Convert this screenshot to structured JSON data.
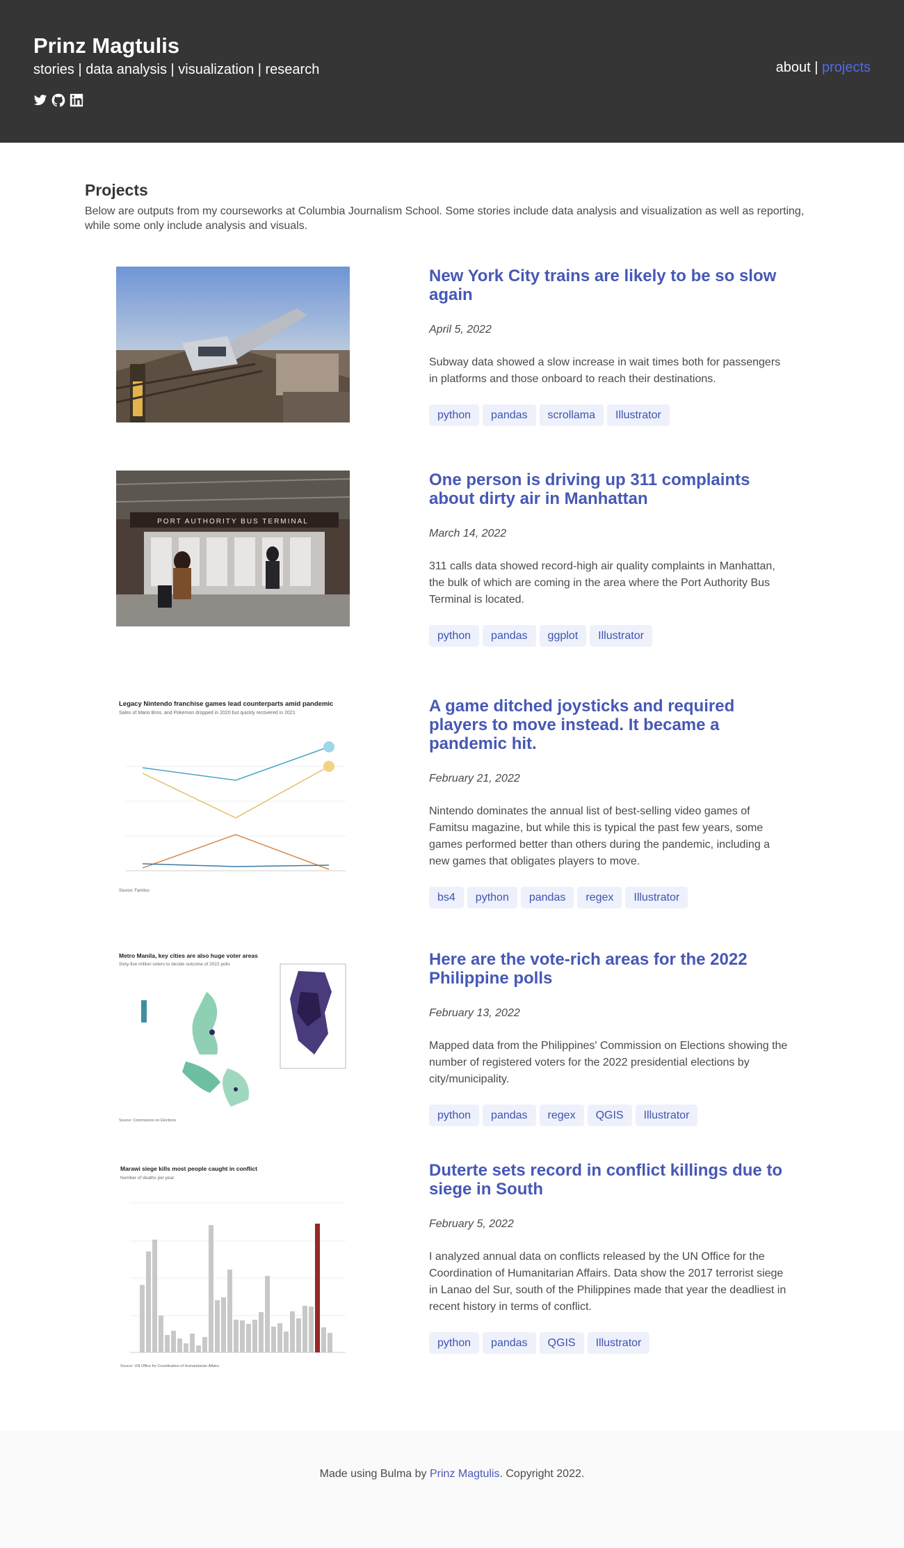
{
  "header": {
    "title": "Prinz Magtulis",
    "subtitle": "stories | data analysis | visualization | research",
    "social_icons": [
      "twitter-icon",
      "github-icon",
      "linkedin-icon"
    ],
    "nav": {
      "about": "about",
      "separator": " | ",
      "projects": "projects"
    }
  },
  "main": {
    "section_title": "Projects",
    "intro": "Below are outputs from my courseworks at Columbia Journalism School. Some stories include data analysis and visualization as well as reporting, while some only include analysis and visuals."
  },
  "projects": [
    {
      "title": "New York City trains are likely to be so slow again",
      "date": "April 5, 2022",
      "description": "Subway data showed a slow increase in wait times both for passengers in platforms and those onboard to reach their destinations.",
      "tags": [
        "python",
        "pandas",
        "scrollama",
        "Illustrator"
      ]
    },
    {
      "title": "One person is driving up 311 complaints about dirty air in Manhattan",
      "date": "March 14, 2022",
      "description": "311 calls data showed record-high air quality complaints in Manhattan, the bulk of which are coming in the area where the Port Authority Bus Terminal is located.",
      "tags": [
        "python",
        "pandas",
        "ggplot",
        "Illustrator"
      ],
      "thumb_text": "PORT AUTHORITY BUS TERMINAL"
    },
    {
      "title": "A game ditched joysticks and required players to move instead. It became a pandemic hit.",
      "date": "February 21, 2022",
      "description": "Nintendo dominates the annual list of best-selling video games of Famitsu magazine, but while this is typical the past few years, some games performed better than others during the pandemic, including a new games that obligates players to move.",
      "tags": [
        "bs4",
        "python",
        "pandas",
        "regex",
        "Illustrator"
      ],
      "thumb_title": "Legacy Nintendo franchise games lead counterparts amid pandemic",
      "thumb_sub": "Sales of Mario Bros. and Pokemon dropped in 2020 but quickly recovered in 2021",
      "thumb_source": "Source: Famitsu"
    },
    {
      "title": "Here are the vote-rich areas for the 2022 Philippine polls",
      "date": "February 13, 2022",
      "description": "Mapped data from the Philippines' Commission on Elections showing the number of registered voters for the 2022 presidential elections by city/municipality.",
      "tags": [
        "python",
        "pandas",
        "regex",
        "QGIS",
        "Illustrator"
      ],
      "thumb_title": "Metro Manila, key cities are also huge voter areas",
      "thumb_sub": "Sixty-five million voters to decide outcome of 2022 polls",
      "thumb_source": "Source: Commission on Elections"
    },
    {
      "title": "Duterte sets record in conflict killings due to siege in South",
      "date": "February 5, 2022",
      "description": "I analyzed annual data on conflicts released by the UN Office for the Coordination of Humanitarian Affairs. Data show the 2017 terrorist siege in Lanao del Sur, south of the Philippines made that year the deadliest in recent history in terms of conflict.",
      "tags": [
        "python",
        "pandas",
        "QGIS",
        "Illustrator"
      ],
      "thumb_title": "Marawi siege kills most people caught in conflict",
      "thumb_sub": "Number of deaths per year",
      "thumb_source": "Source: UN Office for Coordination of Humanitarian Affairs"
    }
  ],
  "footer": {
    "prefix": "Made using Bulma by ",
    "author": "Prinz Magtulis",
    "suffix": ". Copyright 2022."
  }
}
